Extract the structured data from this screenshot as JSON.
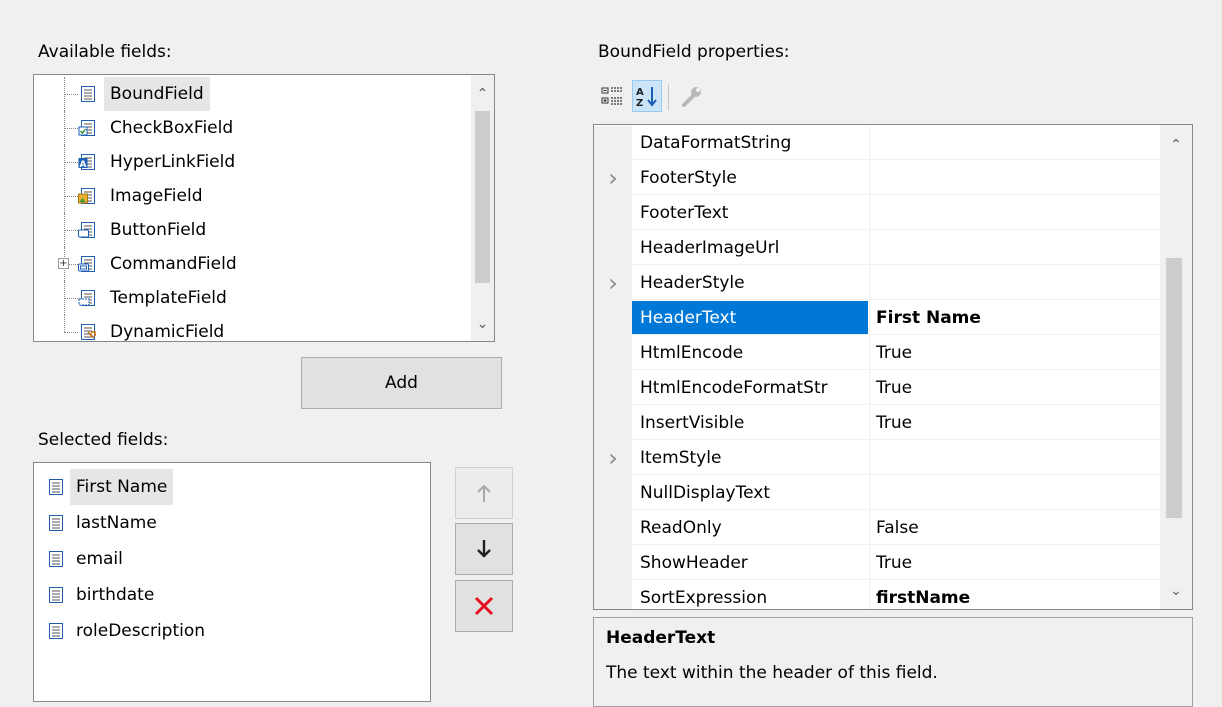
{
  "available": {
    "label": "Available fields:",
    "items": [
      {
        "label": "BoundField",
        "icon": "boundfield-icon"
      },
      {
        "label": "CheckBoxField",
        "icon": "checkboxfield-icon"
      },
      {
        "label": "HyperLinkField",
        "icon": "hyperlinkfield-icon"
      },
      {
        "label": "ImageField",
        "icon": "imagefield-icon"
      },
      {
        "label": "ButtonField",
        "icon": "buttonfield-icon"
      },
      {
        "label": "CommandField",
        "icon": "commandfield-icon"
      },
      {
        "label": "TemplateField",
        "icon": "templatefield-icon"
      },
      {
        "label": "DynamicField",
        "icon": "dynamicfield-icon"
      }
    ],
    "selected_item": "BoundField",
    "add_label": "Add"
  },
  "selected": {
    "label": "Selected fields:",
    "items": [
      {
        "label": "First Name"
      },
      {
        "label": "lastName"
      },
      {
        "label": "email"
      },
      {
        "label": "birthdate"
      },
      {
        "label": "roleDescription"
      }
    ],
    "selected_item": "First Name"
  },
  "properties": {
    "label": "BoundField properties:",
    "toolbar": [
      "categorized-icon",
      "alphabetical-icon",
      "wrench-icon"
    ],
    "rows": [
      {
        "name": "DataFormatString",
        "value": "",
        "expandable": false
      },
      {
        "name": "FooterStyle",
        "value": "",
        "expandable": true
      },
      {
        "name": "FooterText",
        "value": "",
        "expandable": false
      },
      {
        "name": "HeaderImageUrl",
        "value": "",
        "expandable": false
      },
      {
        "name": "HeaderStyle",
        "value": "",
        "expandable": true
      },
      {
        "name": "HeaderText",
        "value": "First Name",
        "expandable": false,
        "bold": true,
        "selected": true
      },
      {
        "name": "HtmlEncode",
        "value": "True",
        "expandable": false
      },
      {
        "name": "HtmlEncodeFormatStr",
        "value": "True",
        "expandable": false
      },
      {
        "name": "InsertVisible",
        "value": "True",
        "expandable": false
      },
      {
        "name": "ItemStyle",
        "value": "",
        "expandable": true
      },
      {
        "name": "NullDisplayText",
        "value": "",
        "expandable": false
      },
      {
        "name": "ReadOnly",
        "value": "False",
        "expandable": false
      },
      {
        "name": "ShowHeader",
        "value": "True",
        "expandable": false
      },
      {
        "name": "SortExpression",
        "value": "firstName",
        "expandable": false,
        "bold": true
      }
    ],
    "description_title": "HeaderText",
    "description_text": "The text within the header of this field."
  },
  "colors": {
    "selection": "#0078d7",
    "delete": "#e81123"
  }
}
